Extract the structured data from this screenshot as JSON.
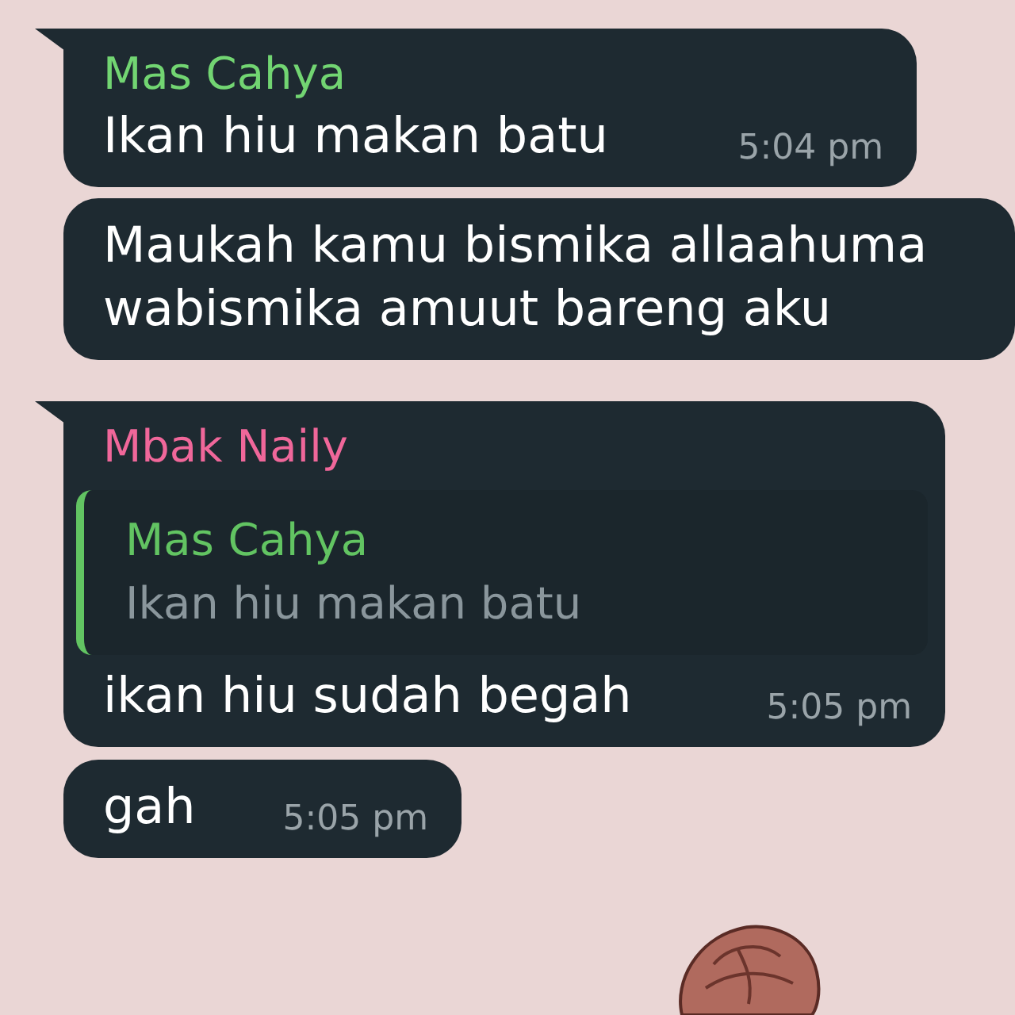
{
  "messages": [
    {
      "tail": true,
      "sender": "Mas Cahya",
      "color": "#72d572",
      "lines": [
        "Ikan hiu makan batu"
      ],
      "time": "5:04 pm"
    },
    {
      "tail": false,
      "lines": [
        "Maukah kamu bismika allaahuma",
        "wabismika amuut bareng aku"
      ]
    },
    {
      "tail": true,
      "sender": "Mbak Naily",
      "color": "#f0679a",
      "reply": {
        "sender": "Mas Cahya",
        "text": "Ikan hiu makan batu"
      },
      "lines": [
        "ikan hiu sudah begah"
      ],
      "time": "5:05 pm"
    },
    {
      "tail": false,
      "lines": [
        "gah"
      ],
      "time": "5:05 pm"
    }
  ],
  "sticker": {
    "kind": "rose"
  }
}
